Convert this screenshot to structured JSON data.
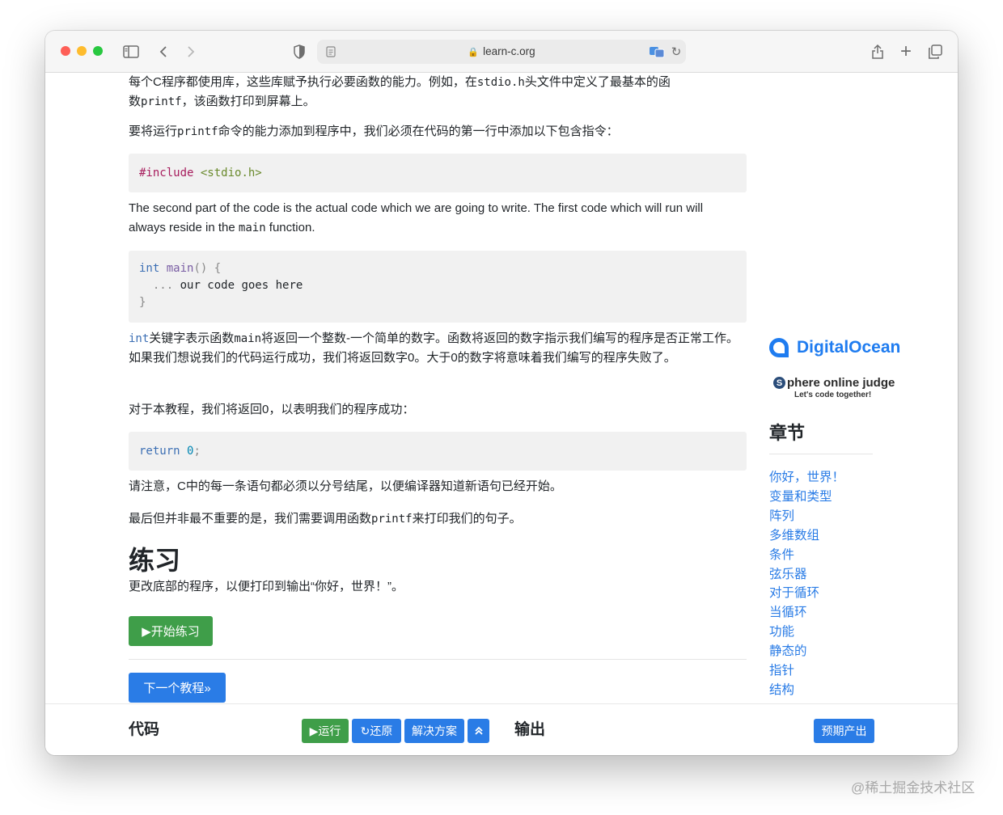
{
  "browser": {
    "url": "learn-c.org",
    "sidebar_toggle_icon": "sidebar-icon",
    "back_icon": "chevron-left-icon",
    "forward_icon": "chevron-right-icon",
    "shield_icon": "shield-icon",
    "reader_icon": "page-icon",
    "translate_icon": "translate-icon",
    "reload_icon": "reload-icon",
    "share_icon": "share-icon",
    "new_tab_icon": "plus-icon",
    "tabs_icon": "tabs-icon"
  },
  "content": {
    "p1_a": "每个C程序都使用库，这些库赋予执行必要函数的能力。例如，在",
    "p1_code1": "stdio.h",
    "p1_b": "头文件中定义了最基本的函",
    "p1_c": "数",
    "p1_code2": "printf",
    "p1_d": "，该函数打印到屏幕上。",
    "p2_a": "要将运行",
    "p2_code": "printf",
    "p2_b": "命令的能力添加到程序中，我们必须在代码的第一行中添加以下包含指令：",
    "code1_pre": "#include",
    "code1_str": "<stdio.h>",
    "p3_a": "The second part of the code is the actual code which we are going to write. The first code which will run will always reside in the ",
    "p3_code": "main",
    "p3_b": " function.",
    "code2_type": "int",
    "code2_fn": "main",
    "code2_paren": "() {",
    "code2_dots": "...",
    "code2_body": "our code goes here",
    "code2_close": "}",
    "p4_code1": "int",
    "p4_a": "关键字表示函数",
    "p4_code2": "main",
    "p4_b": "将返回一个整数-一个简单的数字。函数将返回的数字指示我们编写的程序是否正常工作。如果我们想说我们的代码运行成功，我们将返回数字0。大于0的数字将意味着我们编写的程序失败了。",
    "p5": "对于本教程，我们将返回0，以表明我们的程序成功：",
    "code3_kw": "return",
    "code3_num": "0",
    "code3_semi": ";",
    "p6": "请注意，C中的每一条语句都必须以分号结尾，以便编译器知道新语句已经开始。",
    "p7_a": "最后但并非最不重要的是，我们需要调用函数",
    "p7_code": "printf",
    "p7_b": "来打印我们的句子。",
    "exercise_title": "练习",
    "exercise_text": "更改底部的程序，以便打印到输出“你好，世界！”。",
    "start_button": "▶开始练习",
    "next_button": "下一个教程»"
  },
  "sidebar": {
    "digitalocean": "DigitalOcean",
    "sphere_name": "phere online judge",
    "sphere_badge": "S",
    "sphere_tagline": "Let's code together!",
    "chapters_title": "章节",
    "chapters": [
      "你好，世界！",
      "变量和类型",
      "阵列",
      "多维数组",
      "条件",
      "弦乐器",
      "对于循环",
      "当循环",
      "功能",
      "静态的",
      "指针",
      "结构"
    ]
  },
  "bottom": {
    "code_label": "代码",
    "run_button": "▶运行",
    "reset_button": "↻还原",
    "solution_button": "解决方案",
    "collapse_icon": "double-chevron-up-icon",
    "output_label": "输出",
    "expected_button": "预期产出"
  },
  "watermark": "@稀土掘金技术社区"
}
